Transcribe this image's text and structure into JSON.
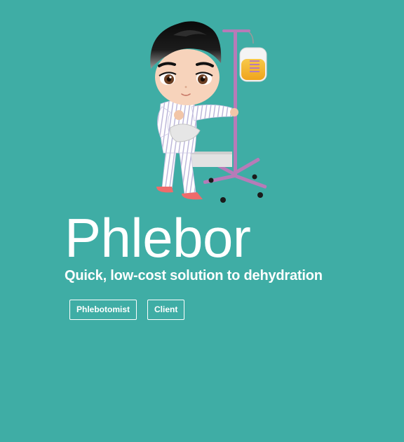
{
  "hero": {
    "title": "Phlebor",
    "tagline": "Quick, low-cost solution to dehydration",
    "illustration_icon": "patient-with-iv-drip-illustration"
  },
  "buttons": {
    "phlebotomist_label": "Phlebotomist",
    "client_label": "Client"
  },
  "colors": {
    "background": "#3fada5",
    "text": "#ffffff",
    "iv_pole": "#b77bb8",
    "iv_fluid": "#f5b72a"
  }
}
